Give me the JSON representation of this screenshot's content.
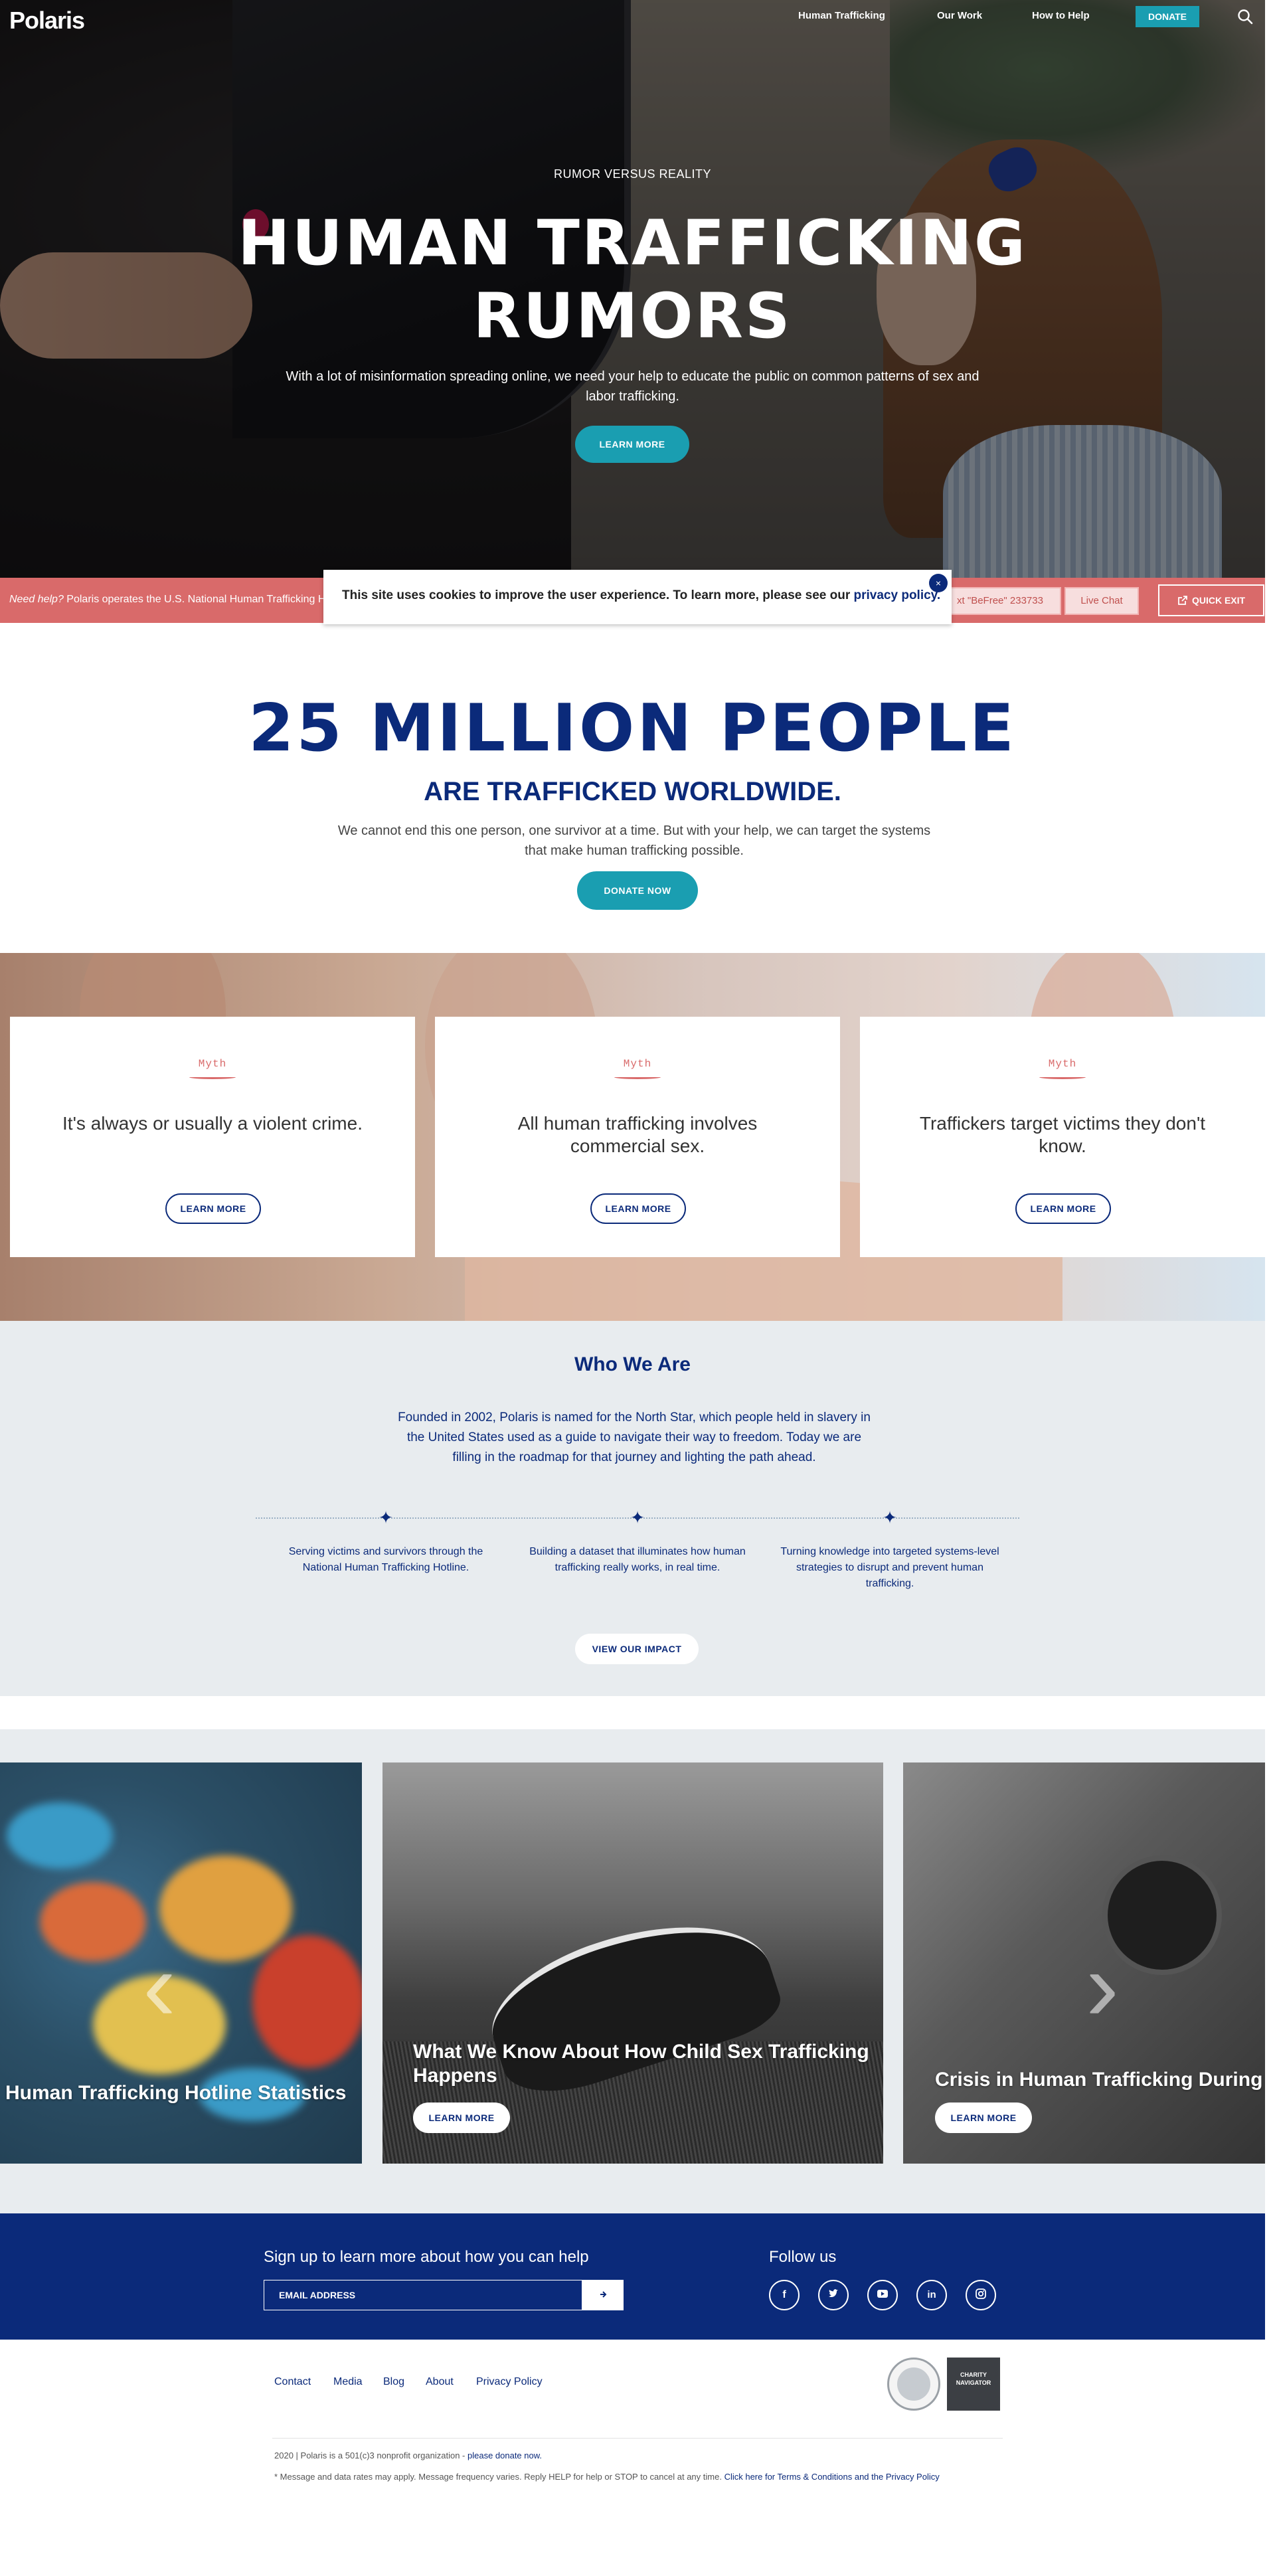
{
  "nav": {
    "logo": "Polaris",
    "links": [
      "Human Trafficking",
      "Our Work",
      "How to Help"
    ],
    "donate": "DONATE",
    "search_icon": "search-icon"
  },
  "hero": {
    "eyebrow": "RUMOR VERSUS REALITY",
    "title_line1": "HUMAN TRAFFICKING",
    "title_line2": "RUMORS",
    "subtitle": "With a lot of misinformation spreading online, we need your help to educate the public on common patterns of sex and labor trafficking.",
    "cta": "LEARN MORE"
  },
  "helpbar": {
    "need_help": "Need help?",
    "text": " Polaris operates the U.S. National Human Trafficking Hotline",
    "text_btn": "xt \"BeFree\" 233733",
    "chat_btn": "Live Chat",
    "exit_btn": "QUICK EXIT"
  },
  "cookie": {
    "message": "This site uses cookies to improve the user experience. To learn more, please see our ",
    "link": "privacy policy.",
    "close": "×"
  },
  "stats": {
    "big": "25 MILLION PEOPLE",
    "sub": "ARE TRAFFICKED WORLDWIDE.",
    "text": "We cannot end this one person, one survivor at a time. But with your help, we can target the systems that make human trafficking possible.",
    "cta": "DONATE NOW"
  },
  "myths": [
    {
      "tag": "Myth",
      "text": "It's always or usually a violent crime.",
      "cta": "LEARN MORE"
    },
    {
      "tag": "Myth",
      "text": "All human trafficking involves commercial sex.",
      "cta": "LEARN MORE"
    },
    {
      "tag": "Myth",
      "text": "Traffickers target victims they don't know.",
      "cta": "LEARN MORE"
    }
  ],
  "who": {
    "title": "Who We Are",
    "text": "Founded in 2002, Polaris is named for the North Star, which people held in slavery in the United States used as a guide to navigate their way to freedom. Today we are filling in the roadmap for that journey and lighting the path ahead.",
    "pillars": [
      "Serving victims and survivors through the National Human Trafficking Hotline.",
      "Building a dataset that illuminates how human trafficking really works, in real time.",
      "Turning knowledge into targeted systems-level strategies to disrupt and prevent human trafficking."
    ],
    "cta": "VIEW OUR IMPACT"
  },
  "carousel": {
    "slides": [
      {
        "caption": "Human Trafficking Hotline Statistics",
        "cta": ""
      },
      {
        "caption_line1": "What We Know About How Child Sex Trafficking",
        "caption_line2": "Happens",
        "cta": "LEARN MORE"
      },
      {
        "caption": "Crisis in Human Trafficking During the P",
        "cta": "LEARN MORE"
      }
    ],
    "prev_icon": "chevron-left-icon",
    "next_icon": "chevron-right-icon"
  },
  "signup": {
    "label": "Sign up to learn more about how you can help",
    "placeholder": "EMAIL ADDRESS",
    "follow": "Follow us",
    "social_icons": [
      "facebook-icon",
      "twitter-icon",
      "youtube-icon",
      "linkedin-icon",
      "instagram-icon"
    ]
  },
  "footer": {
    "links": [
      "Contact",
      "Media",
      "Blog",
      "About",
      "Privacy Policy"
    ],
    "charity_badge": "CHARITY NAVIGATOR",
    "copyright": "2020 | Polaris is a 501(c)3 nonprofit organization - ",
    "donate_link": "please donate now.",
    "disclaimer": "* Message and data rates may apply. Message frequency varies. Reply HELP for help or STOP to cancel at any time. ",
    "terms_link": "Click here for Terms & Conditions and the Privacy Policy"
  },
  "colors": {
    "navy": "#0b2a7a",
    "teal": "#1a9eb1",
    "coral": "#d96a6a",
    "light_bg": "#e8ecef"
  }
}
